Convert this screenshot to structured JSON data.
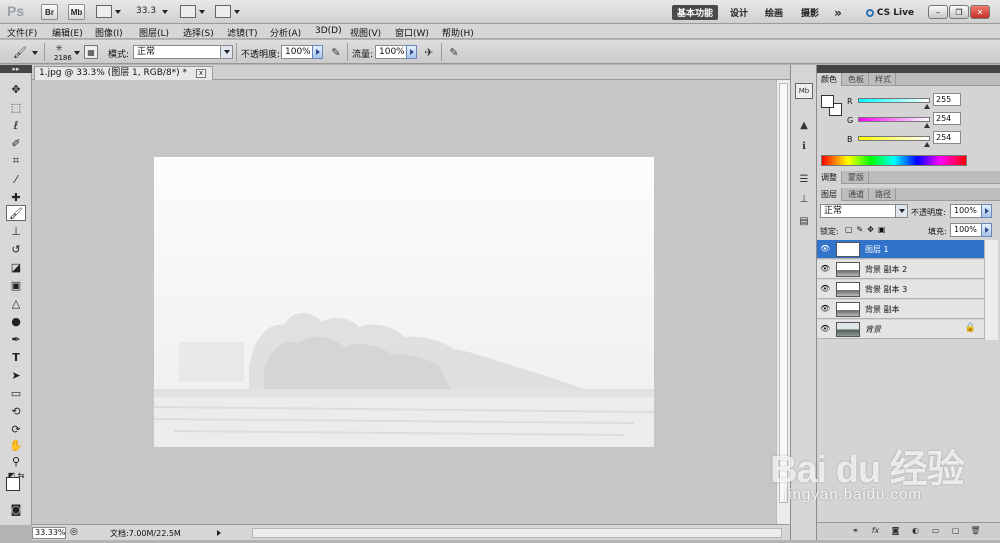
{
  "app": {
    "logo": "Ps",
    "bridge": "Br",
    "mini_bridge": "Mb",
    "zoom": "33.3",
    "workspaces": [
      "基本功能",
      "设计",
      "绘画",
      "摄影"
    ],
    "more": "»",
    "cslive": "CS Live"
  },
  "menu": [
    "文件(F)",
    "编辑(E)",
    "图像(I)",
    "图层(L)",
    "选择(S)",
    "滤镜(T)",
    "分析(A)",
    "3D(D)",
    "视图(V)",
    "窗口(W)",
    "帮助(H)"
  ],
  "options": {
    "brush_size": "2186",
    "mode_label": "模式:",
    "mode_value": "正常",
    "opacity_label": "不透明度:",
    "opacity_value": "100%",
    "flow_label": "流量:",
    "flow_value": "100%"
  },
  "document": {
    "tab_title": "1.jpg @ 33.3% (图层 1, RGB/8*) *",
    "tab_close": "x",
    "zoom_status": "33.33%",
    "doc_info": "文档:7.00M/22.5M"
  },
  "color_panel": {
    "tabs": [
      "颜色",
      "色板",
      "样式"
    ],
    "r_label": "R",
    "g_label": "G",
    "b_label": "B",
    "r": "255",
    "g": "254",
    "b": "254"
  },
  "adjust_panel": {
    "tabs": [
      "调整",
      "蒙版"
    ]
  },
  "layers_panel": {
    "tabs": [
      "图层",
      "通道",
      "路径"
    ],
    "blend_mode": "正常",
    "opacity_label": "不透明度:",
    "opacity_value": "100%",
    "lock_label": "锁定:",
    "fill_label": "填充:",
    "fill_value": "100%",
    "layers": [
      {
        "name": "图层 1"
      },
      {
        "name": "背景 副本 2"
      },
      {
        "name": "背景 副本 3"
      },
      {
        "name": "背景 副本"
      },
      {
        "name": "背景"
      }
    ]
  },
  "watermark": {
    "brand": "Bai du 经验",
    "url": "jingyan.baidu.com"
  },
  "colors": {
    "selected_layer": "#3173c9",
    "canvas_bg": "#c6c6c6"
  }
}
